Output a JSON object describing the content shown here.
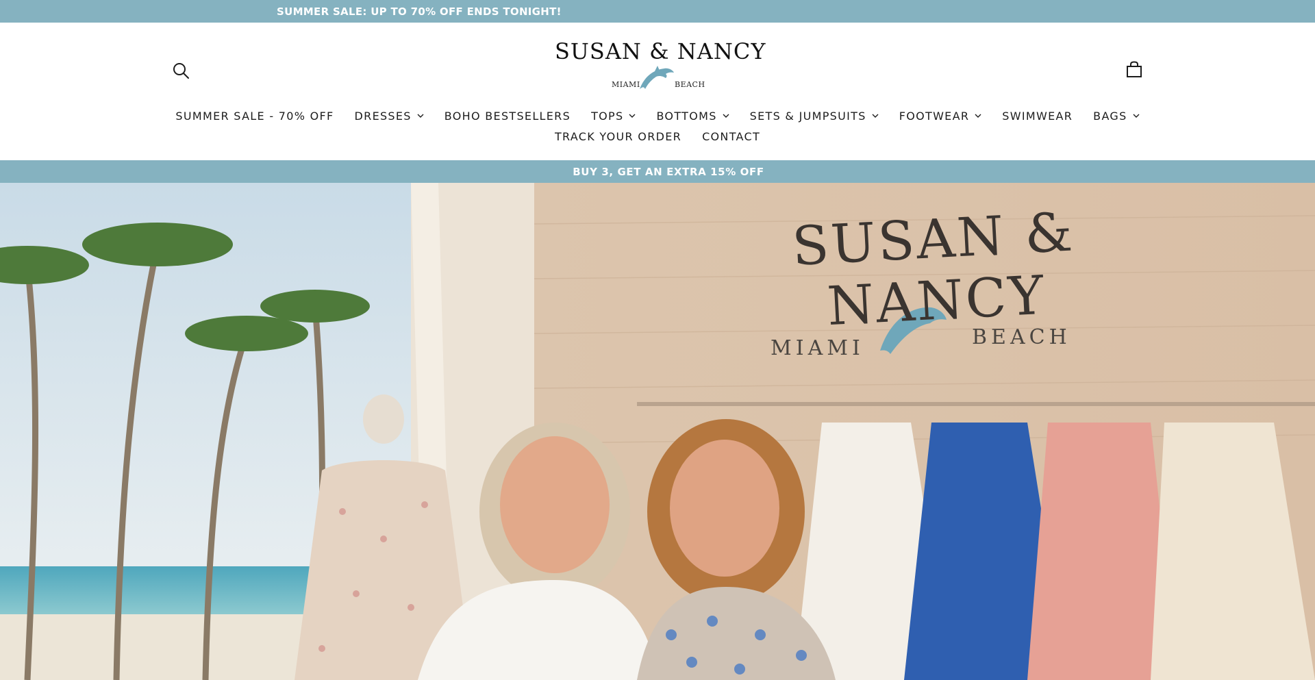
{
  "announcement_top": {
    "text": "SUMMER SALE: UP TO 70% OFF ENDS TONIGHT!"
  },
  "header": {
    "logo": {
      "name": "SUSAN & NANCY",
      "left_word": "MIAMI",
      "right_word": "BEACH"
    },
    "search_icon": "search-icon",
    "cart_icon": "shopping-bag-icon"
  },
  "nav": {
    "row1": [
      {
        "label": "SUMMER SALE - 70% OFF",
        "dropdown": false
      },
      {
        "label": "DRESSES",
        "dropdown": true
      },
      {
        "label": "BOHO BESTSELLERS",
        "dropdown": false
      },
      {
        "label": "TOPS",
        "dropdown": true
      },
      {
        "label": "BOTTOMS",
        "dropdown": true
      },
      {
        "label": "SETS & JUMPSUITS",
        "dropdown": true
      },
      {
        "label": "FOOTWEAR",
        "dropdown": true
      },
      {
        "label": "SWIMWEAR",
        "dropdown": false
      },
      {
        "label": "BAGS",
        "dropdown": true
      }
    ],
    "row2": [
      {
        "label": "TRACK YOUR ORDER",
        "dropdown": false
      },
      {
        "label": "CONTACT",
        "dropdown": false
      }
    ]
  },
  "announcement_bottom": {
    "text": "BUY 3, GET AN EXTRA 15% OFF"
  },
  "hero": {
    "wall_sign": {
      "name": "SUSAN & NANCY",
      "left_word": "MIAMI",
      "right_word": "BEACH"
    }
  },
  "colors": {
    "announcement_bg": "#85b2c0",
    "announcement_text": "#ffffff",
    "nav_text": "#1c1c1c",
    "dolphin": "#6fa7ba"
  }
}
